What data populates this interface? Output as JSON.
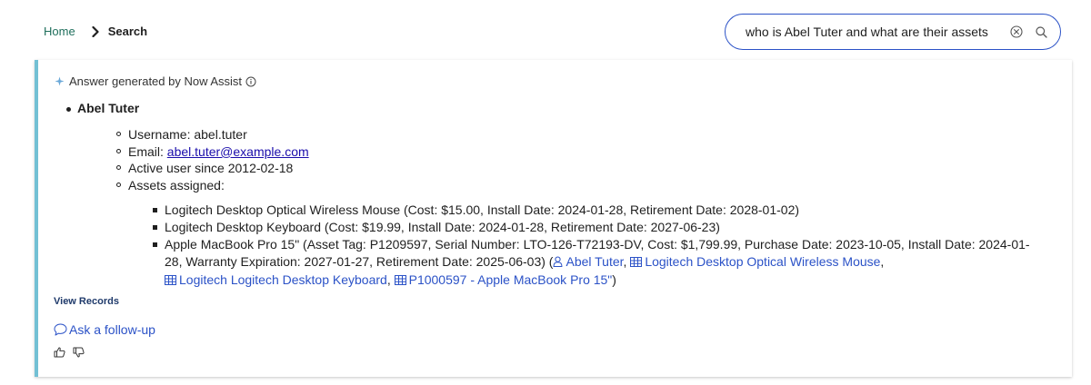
{
  "breadcrumb": {
    "home": "Home",
    "current": "Search"
  },
  "search": {
    "query": "who is Abel Tuter and what are their assets",
    "placeholder": ""
  },
  "answer": {
    "header": "Answer generated by Now Assist",
    "person": {
      "name": "Abel Tuter",
      "username_label": "Username: ",
      "username": "abel.tuter",
      "email_label": "Email: ",
      "email": "abel.tuter@example.com",
      "active_since": "Active user since 2012-02-18",
      "assets_label": "Assets assigned:"
    },
    "assets": [
      {
        "text": "Logitech Desktop Optical Wireless Mouse (Cost: $15.00, Install Date: 2024-01-28, Retirement Date: 2028-01-02)"
      },
      {
        "text": "Logitech Desktop Keyboard (Cost: $19.99, Install Date: 2024-01-28, Retirement Date: 2027-06-23)"
      },
      {
        "text": "Apple MacBook Pro 15\" (Asset Tag: P1209597, Serial Number: LTO-126-T72193-DV, Cost: $1,799.99, Purchase Date: 2023-10-05, Install Date: 2024-01-28, Warranty Expiration: 2027-01-27, Retirement Date: 2025-06-03) ("
      }
    ],
    "references": [
      {
        "label": "Abel Tuter",
        "icon": "user-icon"
      },
      {
        "label": "Logitech Desktop Optical Wireless Mouse",
        "icon": "table-icon"
      },
      {
        "label": "Logitech Logitech Desktop Keyboard",
        "icon": "table-icon"
      },
      {
        "label": "P1000597 - Apple MacBook Pro 15\"",
        "icon": "table-icon"
      }
    ],
    "ref_separator": ", ",
    "ref_close": ")",
    "view_records": "View Records",
    "follow_up": "Ask a follow-up"
  },
  "colors": {
    "accent": "#2b52c7",
    "panel_border": "#73c0d4",
    "home_link": "#1f6f5c",
    "sparkle": "#6aa8d8"
  },
  "icons": {
    "separator": "chevron-right-icon",
    "clear": "clear-circle-icon",
    "search": "search-icon",
    "info": "info-icon",
    "sparkle": "sparkle-icon",
    "chat": "chat-bubble-icon",
    "thumbs_up": "thumbs-up-icon",
    "thumbs_down": "thumbs-down-icon"
  }
}
